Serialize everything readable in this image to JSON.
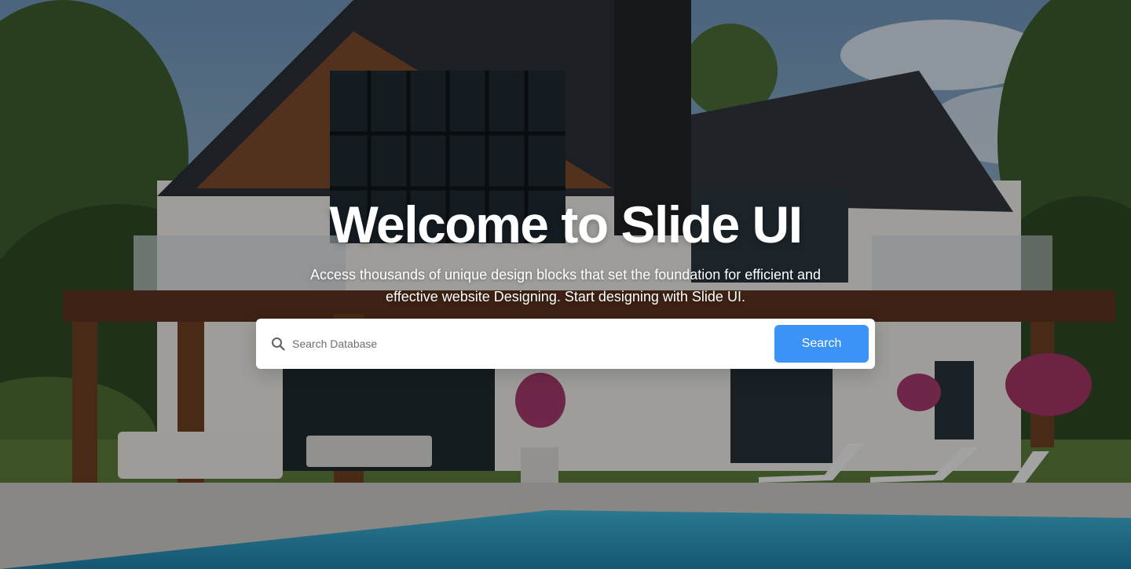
{
  "hero": {
    "title": "Welcome to Slide UI",
    "subtitle": "Access thousands of unique design blocks that set the foundation for efficient and effective website Designing. Start designing with Slide UI."
  },
  "search": {
    "placeholder": "Search Database",
    "value": "",
    "button_label": "Search",
    "icon": "search-icon"
  },
  "colors": {
    "accent": "#3b93f5",
    "text": "#ffffff"
  }
}
